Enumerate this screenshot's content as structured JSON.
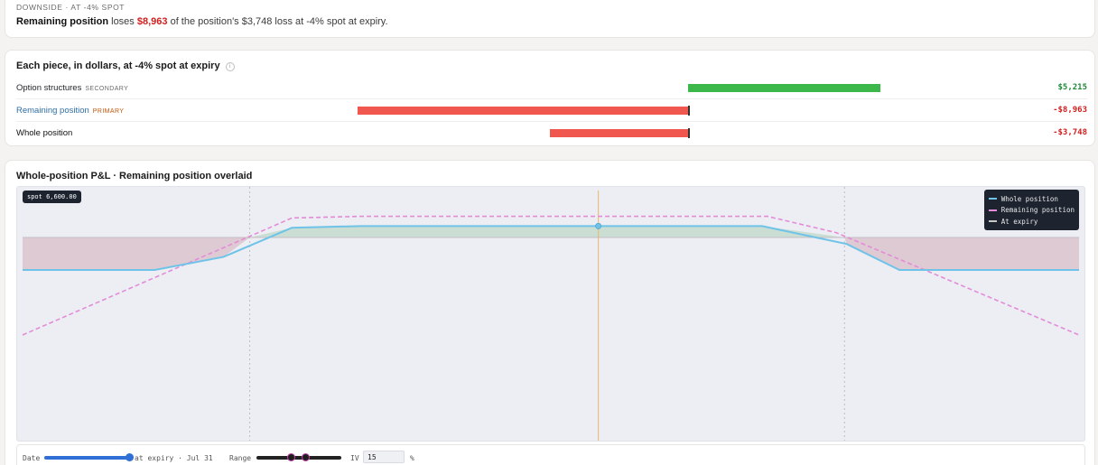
{
  "summary": {
    "eyebrow": "DOWNSIDE · AT -4% SPOT",
    "subject": "Remaining position",
    "verb": " loses ",
    "amount": "$8,963",
    "rest": " of the position's $3,748 loss at -4% spot at expiry."
  },
  "pieces": {
    "title": "Each piece, in dollars, at -4% spot at expiry",
    "info_icon": "info-icon",
    "rows": [
      {
        "label": "Option structures",
        "tag": "SECONDARY",
        "value": 5215,
        "value_text": "$5,215",
        "label_color": "#1f2328",
        "tag_color": "#6b6b6b",
        "bar_color": "#3cb84a",
        "value_color": "#1f8a3a"
      },
      {
        "label": "Remaining position",
        "tag": "PRIMARY",
        "value": -8963,
        "value_text": "-$8,963",
        "label_color": "#2f6fa3",
        "tag_color": "#c2570c",
        "bar_color": "#f0574f",
        "value_color": "#d11f1f"
      },
      {
        "label": "Whole position",
        "tag": "",
        "value": -3748,
        "value_text": "-$3,748",
        "label_color": "#111111",
        "tag_color": "#6b6b6b",
        "bar_color": "#f0574f",
        "value_color": "#d11f1f"
      }
    ]
  },
  "chart": {
    "title": "Whole-position P&L · Remaining position overlaid",
    "spot_chip": "spot 6,600.00",
    "legend": [
      {
        "label": "Whole position",
        "color": "#6fc3e8",
        "style": "solid"
      },
      {
        "label": "Remaining position",
        "color": "#e48bd8",
        "style": "dashed"
      },
      {
        "label": "At expiry",
        "color": "#c8c8c8",
        "style": "dashed"
      }
    ]
  },
  "controls": {
    "date_label": "Date",
    "date_value_text": "at expiry · Jul 31",
    "date_fraction": 1.0,
    "range_label": "Range",
    "range_low_fraction": 0.4,
    "range_high_fraction": 0.57,
    "iv_label": "IV",
    "iv_value": "15",
    "iv_unit": "%"
  },
  "chart_data": {
    "type": "line",
    "title": "Whole-position P&L · Remaining position overlaid",
    "current_spot": 6600.0,
    "series": [
      {
        "name": "Whole position",
        "x": [
          0,
          0.125,
          0.19,
          0.255,
          0.32,
          0.5,
          0.7,
          0.78,
          0.83,
          1
        ],
        "y": [
          -1.0,
          -1.0,
          -0.6,
          0.3,
          0.35,
          0.35,
          0.35,
          -0.2,
          -1.0,
          -1.0
        ]
      },
      {
        "name": "Remaining position",
        "x": [
          0,
          0.255,
          0.32,
          0.5,
          0.705,
          0.77,
          1
        ],
        "y": [
          -3.0,
          0.6,
          0.65,
          0.65,
          0.65,
          0.15,
          -3.0
        ]
      }
    ]
  },
  "colors": {
    "positive_bar": "#3cb84a",
    "negative_bar": "#f0574f",
    "whole_line": "#6fc3e8",
    "remaining_line": "#e48bd8",
    "spot_line": "#e8b86a"
  }
}
